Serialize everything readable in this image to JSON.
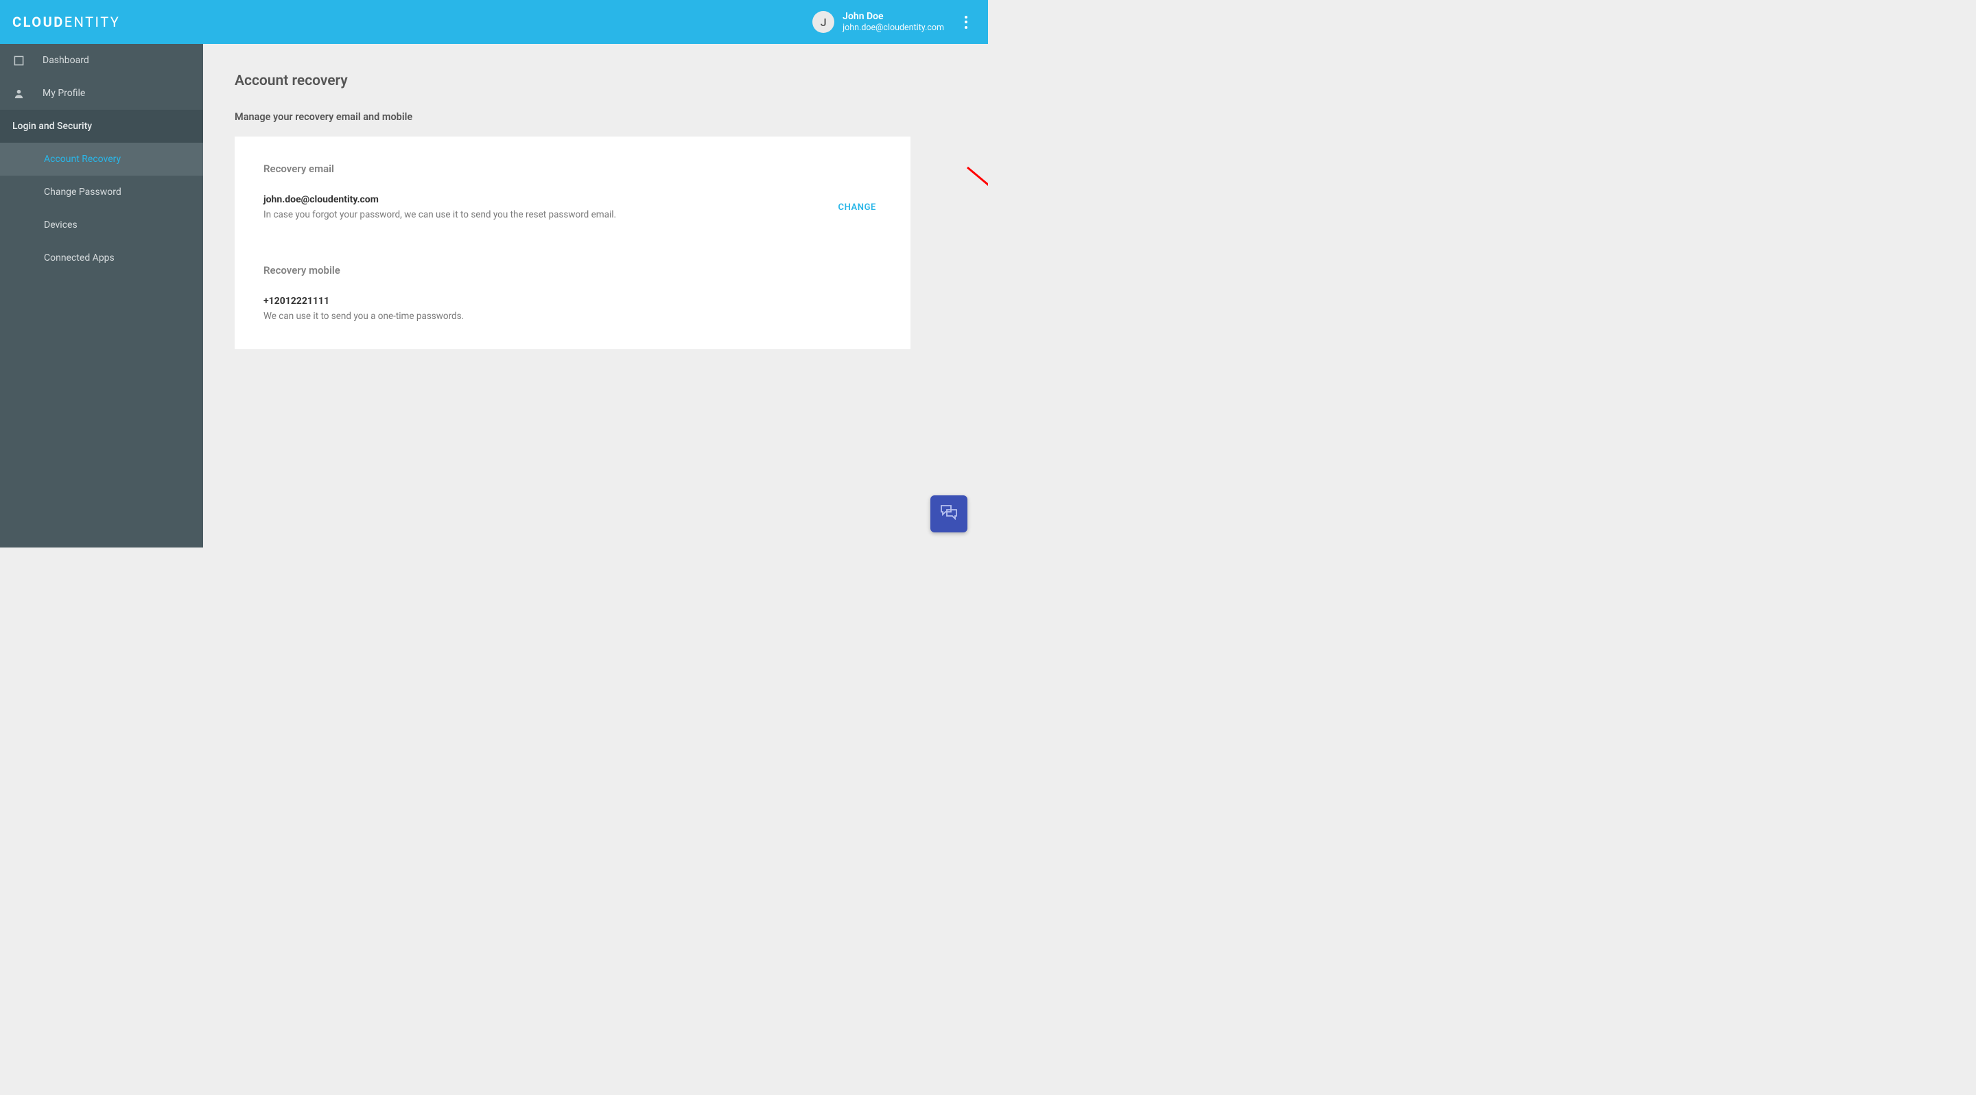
{
  "brand": {
    "bold": "CLOUD",
    "rest": "ENTITY"
  },
  "user": {
    "initial": "J",
    "name": "John Doe",
    "email": "john.doe@cloudentity.com"
  },
  "sidebar": {
    "dashboard": "Dashboard",
    "my_profile": "My Profile",
    "section": "Login and Security",
    "items": [
      {
        "label": "Account Recovery",
        "active": true
      },
      {
        "label": "Change Password",
        "active": false
      },
      {
        "label": "Devices",
        "active": false
      },
      {
        "label": "Connected Apps",
        "active": false
      }
    ]
  },
  "page": {
    "title": "Account recovery",
    "subtitle": "Manage your recovery email and mobile"
  },
  "recovery_email": {
    "label": "Recovery email",
    "value": "john.doe@cloudentity.com",
    "desc": "In case you forgot your password, we can use it to send you the reset password email.",
    "change": "CHANGE"
  },
  "recovery_mobile": {
    "label": "Recovery mobile",
    "value": "+12012221111",
    "desc": "We can use it to send you a one-time passwords."
  }
}
